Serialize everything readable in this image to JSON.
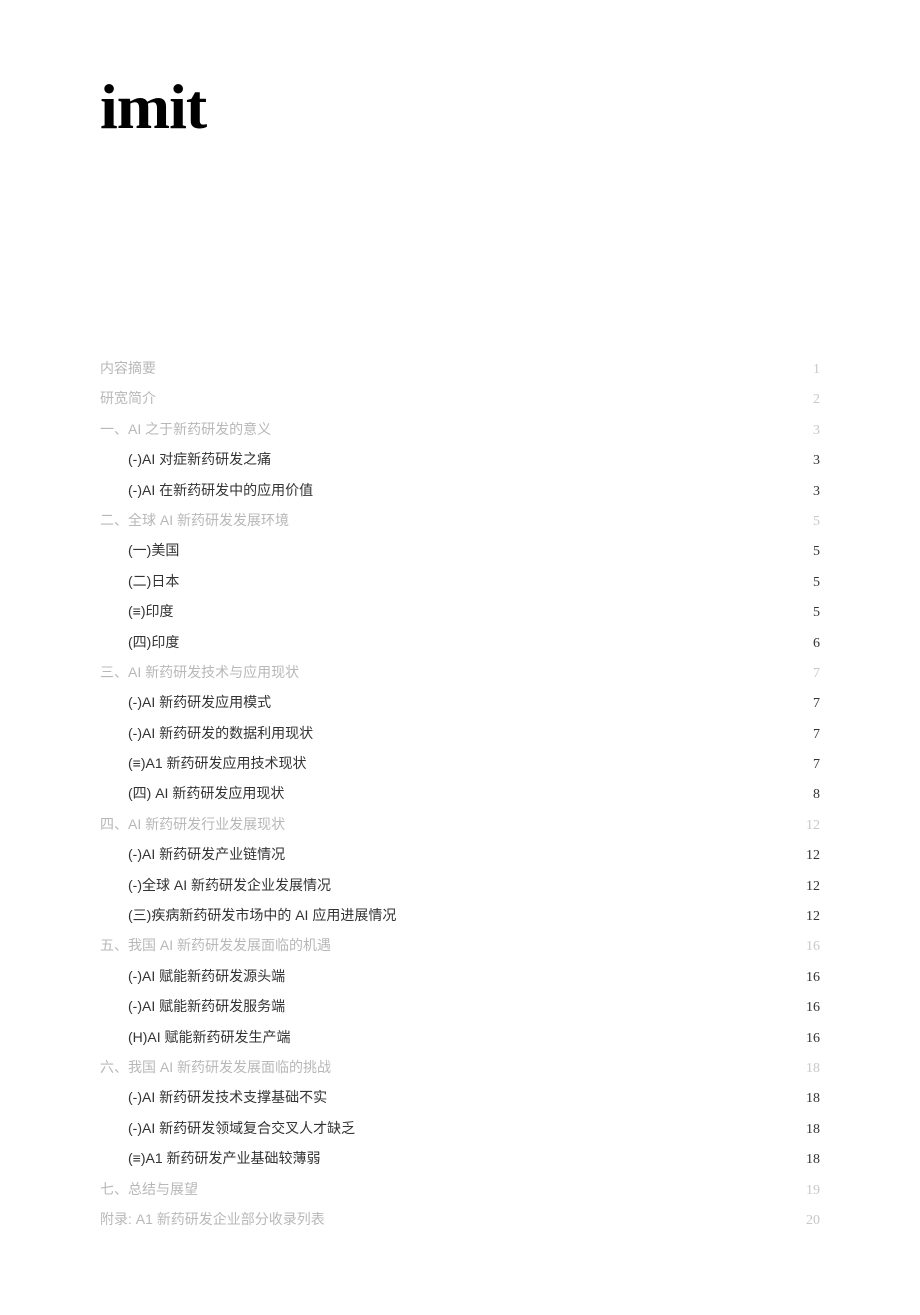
{
  "logo": "imit",
  "toc": [
    {
      "level": 0,
      "label": "内容摘要",
      "page": "1"
    },
    {
      "level": 0,
      "label": "研宽简介",
      "page": "2"
    },
    {
      "level": 0,
      "label": "一、AI 之于新药研发的意义",
      "page": "3"
    },
    {
      "level": 1,
      "label": "(-)AI 对症新药研发之痛",
      "page": "3"
    },
    {
      "level": 1,
      "label": "(-)AI 在新药研发中的应用价值",
      "page": "3"
    },
    {
      "level": 0,
      "label": "二、全球 AI 新药研发发展环境",
      "page": "5"
    },
    {
      "level": 1,
      "label": "(一)美国",
      "page": "5"
    },
    {
      "level": 1,
      "label": "(二)日本",
      "page": "5"
    },
    {
      "level": 1,
      "label": "(≡)印度",
      "page": "5"
    },
    {
      "level": 1,
      "label": "(四)印度",
      "page": "6"
    },
    {
      "level": 0,
      "label": "三、AI 新药研发技术与应用现状",
      "page": "7"
    },
    {
      "level": 1,
      "label": "(-)AI 新药研发应用模式",
      "page": "7"
    },
    {
      "level": 1,
      "label": "(-)AI 新药研发的数据利用现状",
      "page": "7"
    },
    {
      "level": 1,
      "label": "(≡)A1 新药研发应用技术现状",
      "page": "7"
    },
    {
      "level": 1,
      "label": "(四) AI 新药研发应用现状",
      "page": "8"
    },
    {
      "level": 0,
      "label": "四、AI 新药研发行业发展现状",
      "page": "12"
    },
    {
      "level": 1,
      "label": "(-)AI 新药研发产业链情况",
      "page": "12"
    },
    {
      "level": 1,
      "label": "(-)全球 AI 新药研发企业发展情况",
      "page": "12"
    },
    {
      "level": 1,
      "label": "(三)疾病新药研发市场中的 AI 应用进展情况",
      "page": "12"
    },
    {
      "level": 0,
      "label": "五、我国 AI 新药研发发展面临的机遇",
      "page": "16"
    },
    {
      "level": 1,
      "label": "(-)AI 赋能新药研发源头端",
      "page": "16"
    },
    {
      "level": 1,
      "label": "(-)AI 赋能新药研发服务端",
      "page": "16"
    },
    {
      "level": 1,
      "label": "(H)AI 赋能新药研发生产端",
      "page": "16"
    },
    {
      "level": 0,
      "label": "六、我国 AI 新药研发发展面临的挑战",
      "page": "18"
    },
    {
      "level": 1,
      "label": "(-)AI 新药研发技术支撑基础不实",
      "page": "18"
    },
    {
      "level": 1,
      "label": "(-)AI 新药研发领域复合交叉人才缺乏",
      "page": "18"
    },
    {
      "level": 1,
      "label": "(≡)A1 新药研发产业基础较薄弱",
      "page": "18"
    },
    {
      "level": 0,
      "label": "七、总结与展望",
      "page": "19"
    },
    {
      "level": 0,
      "label": "附录: A1 新药研发企业部分收录列表",
      "page": "20"
    }
  ]
}
